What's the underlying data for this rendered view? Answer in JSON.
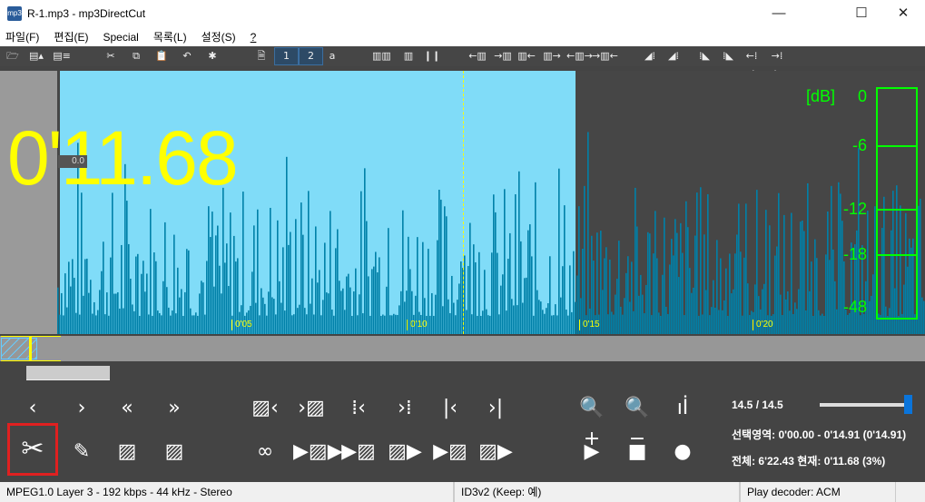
{
  "window": {
    "title": "R-1.mp3 - mp3DirectCut",
    "icon": "mp3",
    "minimize": "—",
    "maximize": "☐",
    "close": "✕"
  },
  "menu": [
    "파일(F)",
    "편집(E)",
    "Special",
    "목록(L)",
    "설정(S)",
    "?"
  ],
  "toolbar": [
    {
      "name": "open-icon",
      "glyph": "🗁"
    },
    {
      "name": "save-audio-icon",
      "glyph": "▤▴"
    },
    {
      "name": "save-list-icon",
      "glyph": "▤≡"
    },
    {
      "name": "cut-icon",
      "glyph": "✂"
    },
    {
      "name": "copy-icon",
      "glyph": "⧉"
    },
    {
      "name": "paste-icon",
      "glyph": "📋"
    },
    {
      "name": "undo-icon",
      "glyph": "↶"
    },
    {
      "name": "settings-icon",
      "glyph": "✱"
    },
    {
      "name": "page-icon",
      "glyph": "🗎"
    },
    {
      "name": "page-1-icon",
      "glyph": "1"
    },
    {
      "name": "page-2-icon",
      "glyph": "2"
    },
    {
      "name": "page-a-icon",
      "glyph": "a"
    },
    {
      "name": "split-icon",
      "glyph": "▥▥"
    },
    {
      "name": "split2-icon",
      "glyph": "▥"
    },
    {
      "name": "pause-marks-icon",
      "glyph": "❙❙"
    },
    {
      "name": "move-left-a-icon",
      "glyph": "←▥"
    },
    {
      "name": "move-right-a-icon",
      "glyph": "→▥"
    },
    {
      "name": "move-left-b-icon",
      "glyph": "▥←"
    },
    {
      "name": "move-right-b-icon",
      "glyph": "▥→"
    },
    {
      "name": "expand-a-icon",
      "glyph": "←▥→"
    },
    {
      "name": "expand-b-icon",
      "glyph": "→▥←"
    },
    {
      "name": "level-a-icon",
      "glyph": "◢⁞"
    },
    {
      "name": "level-b-icon",
      "glyph": "◢⁞"
    },
    {
      "name": "level-c-icon",
      "glyph": "⁞◣"
    },
    {
      "name": "level-d-icon",
      "glyph": "⁞◣"
    },
    {
      "name": "fade-a-icon",
      "glyph": "←⁞→"
    },
    {
      "name": "fade-b-icon",
      "glyph": "→⁞←"
    }
  ],
  "display": {
    "time": "0'11.68",
    "zero_label": "0.0",
    "ticks": [
      "0'05",
      "0'10",
      "0'15",
      "0'20"
    ],
    "db_unit": "[dB]",
    "db_labels": [
      "0",
      "-6",
      "-12",
      "-18",
      "-48"
    ]
  },
  "colors": {
    "selection": "#80dcf8",
    "wave": "#0080a8",
    "accent": "#ffff00",
    "meter": "#00ff00"
  },
  "controls": {
    "row1": [
      {
        "name": "prev-button",
        "glyph": "‹"
      },
      {
        "name": "next-button",
        "glyph": "›"
      },
      {
        "name": "rewind-button",
        "glyph": "«"
      },
      {
        "name": "forward-button",
        "glyph": "»"
      },
      {
        "name": "sel-start-left-button",
        "glyph": "▨‹"
      },
      {
        "name": "sel-end-right-button",
        "glyph": "›▨"
      },
      {
        "name": "cue-left-button",
        "glyph": "⁞‹"
      },
      {
        "name": "cue-right-button",
        "glyph": "›⁞"
      },
      {
        "name": "go-start-button",
        "glyph": "|‹"
      },
      {
        "name": "go-end-button",
        "glyph": "›|"
      },
      {
        "name": "zoom-in-button",
        "glyph": "🔍+"
      },
      {
        "name": "zoom-out-button",
        "glyph": "🔍−"
      },
      {
        "name": "levels-button",
        "glyph": "ıİ"
      }
    ],
    "row2": [
      {
        "name": "cut-button",
        "glyph": "✂"
      },
      {
        "name": "pencil-button",
        "glyph": "✎"
      },
      {
        "name": "select-all-button",
        "glyph": "▨"
      },
      {
        "name": "select-button",
        "glyph": "▨"
      },
      {
        "name": "loop-button",
        "glyph": "∞"
      },
      {
        "name": "play-selection-button",
        "glyph": "▶▨▶"
      },
      {
        "name": "play-to-cue-button",
        "glyph": "▶▨"
      },
      {
        "name": "play-from-cue-button",
        "glyph": "▨▶"
      },
      {
        "name": "play-end-button",
        "glyph": "▶▨"
      },
      {
        "name": "play-sel-end-button",
        "glyph": "▨▶"
      },
      {
        "name": "play-button",
        "glyph": "▶"
      },
      {
        "name": "stop-button",
        "glyph": "■"
      },
      {
        "name": "record-button",
        "glyph": "●"
      }
    ]
  },
  "info": {
    "zoom": "14.5  /  14.5",
    "zoom_fraction": 1.0,
    "selection": "선택영역: 0'00.00 - 0'14.91 (0'14.91)",
    "total": "전체: 6'22.43   현재: 0'11.68   (3%)"
  },
  "status": {
    "format": "MPEG1.0 Layer 3 - 192 kbps - 44 kHz - Stereo",
    "id3": "ID3v2 (Keep: 예)",
    "decoder": "Play decoder: ACM"
  }
}
